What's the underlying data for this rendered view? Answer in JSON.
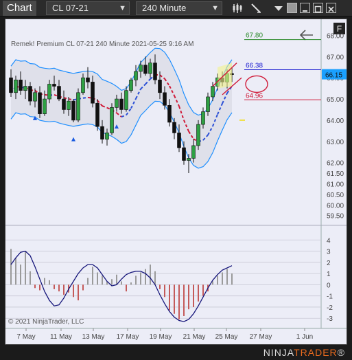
{
  "titlebar": {
    "title": "Chart",
    "instrument": "CL 07-21",
    "interval": "240 Minute",
    "icons": [
      "bar-style-icon",
      "drawing-tool-icon",
      "properties-icon"
    ],
    "window_buttons": [
      "minimize-icon",
      "maximize-icon",
      "close-icon"
    ]
  },
  "chart": {
    "header": "Remek!  Premium  CL 07-21  240 Minute  2021-05-25 9:16 AM",
    "copyright": "© 2021 NinjaTrader, LLC",
    "panel_badge": "F",
    "back_arrow": "left-arrow-icon",
    "price_ticks": [
      "68.00",
      "67.00",
      "66.00",
      "65.00",
      "64.00",
      "63.00",
      "62.00",
      "61.50",
      "61.00",
      "60.50",
      "60.00",
      "59.50"
    ],
    "osc_ticks": [
      "4",
      "3",
      "2",
      "1",
      "0",
      "-1",
      "-2",
      "-3"
    ],
    "date_ticks": [
      "7 May",
      "11 May",
      "13 May",
      "17 May",
      "19 May",
      "21 May",
      "25 May",
      "27 May",
      "1 Jun"
    ],
    "level_labels": {
      "target": "67.80",
      "mid": "66.38",
      "stop": "64.96",
      "last": "66.15"
    },
    "colors": {
      "target": "#2e8b2e",
      "mid": "#1a1ad0",
      "stop": "#d01836",
      "band": "#1e8fff",
      "last_bg": "#1aa0ff"
    }
  },
  "chart_data": {
    "type": "candlestick",
    "ylim": [
      59.2,
      68.6
    ],
    "ohlc": [
      [
        66.0,
        66.4,
        65.1,
        65.3
      ],
      [
        65.3,
        66.1,
        65.0,
        65.9
      ],
      [
        65.9,
        66.3,
        65.2,
        65.4
      ],
      [
        65.4,
        65.9,
        65.0,
        65.6
      ],
      [
        65.6,
        65.8,
        64.7,
        64.9
      ],
      [
        64.9,
        65.5,
        64.6,
        65.3
      ],
      [
        65.3,
        65.6,
        64.1,
        64.3
      ],
      [
        64.3,
        65.4,
        64.2,
        65.0
      ],
      [
        65.0,
        65.9,
        64.8,
        65.7
      ],
      [
        65.7,
        66.1,
        65.4,
        65.6
      ],
      [
        65.6,
        65.9,
        64.9,
        65.0
      ],
      [
        65.0,
        65.4,
        64.3,
        64.5
      ],
      [
        64.5,
        65.1,
        64.2,
        64.9
      ],
      [
        64.9,
        65.0,
        63.9,
        64.0
      ],
      [
        64.0,
        65.5,
        63.9,
        65.3
      ],
      [
        65.3,
        66.2,
        65.2,
        66.0
      ],
      [
        66.0,
        66.5,
        65.5,
        65.8
      ],
      [
        65.8,
        66.1,
        64.6,
        64.8
      ],
      [
        64.8,
        65.0,
        63.5,
        63.7
      ],
      [
        63.7,
        64.0,
        62.9,
        63.1
      ],
      [
        63.1,
        63.6,
        62.8,
        63.4
      ],
      [
        63.4,
        64.8,
        63.3,
        64.6
      ],
      [
        64.6,
        65.2,
        64.4,
        65.0
      ],
      [
        65.0,
        65.3,
        64.3,
        64.5
      ],
      [
        64.5,
        65.6,
        64.4,
        65.4
      ],
      [
        65.4,
        66.0,
        65.3,
        65.9
      ],
      [
        65.9,
        66.6,
        65.6,
        66.3
      ],
      [
        66.3,
        66.8,
        66.0,
        66.6
      ],
      [
        66.6,
        67.0,
        66.1,
        66.2
      ],
      [
        66.2,
        66.9,
        66.0,
        66.7
      ],
      [
        66.7,
        67.1,
        65.7,
        65.9
      ],
      [
        65.9,
        66.3,
        65.0,
        65.3
      ],
      [
        65.3,
        65.6,
        64.5,
        64.7
      ],
      [
        64.7,
        65.0,
        63.7,
        63.9
      ],
      [
        63.9,
        64.1,
        63.1,
        63.4
      ],
      [
        63.4,
        63.8,
        62.5,
        62.7
      ],
      [
        62.7,
        63.0,
        61.9,
        62.1
      ],
      [
        62.1,
        62.4,
        61.5,
        62.2
      ],
      [
        62.2,
        63.1,
        62.0,
        62.8
      ],
      [
        62.8,
        64.0,
        62.6,
        63.8
      ],
      [
        63.8,
        64.6,
        63.6,
        64.4
      ],
      [
        64.4,
        65.3,
        64.2,
        65.1
      ],
      [
        65.1,
        65.8,
        64.9,
        65.6
      ],
      [
        65.6,
        66.2,
        65.4,
        66.0
      ],
      [
        66.0,
        66.3,
        65.6,
        65.8
      ],
      [
        65.8,
        66.4,
        65.5,
        66.2
      ],
      [
        66.2,
        66.5,
        65.8,
        66.15
      ]
    ],
    "oscillator_histogram": [
      3.2,
      2.4,
      1.8,
      3.0,
      1.2,
      -0.3,
      -0.5,
      0.6,
      0.4,
      -0.4,
      -0.6,
      -0.9,
      -0.7,
      -1.1,
      -1.4,
      -0.5,
      0.6,
      1.6,
      1.1,
      0.8,
      0.3,
      0.5,
      0.9,
      0.3,
      -0.6,
      0.2,
      0.8,
      1.1,
      1.4,
      1.8,
      1.2,
      -0.4,
      -1.1,
      -2.3,
      -2.6,
      -3.1,
      -2.8,
      -2.2,
      -2.0,
      -1.5,
      -1.0,
      -0.6,
      0.3,
      0.8,
      1.1,
      1.4,
      1.0
    ],
    "oscillator_line": [
      1.8,
      2.4,
      2.9,
      3.0,
      2.6,
      1.6,
      0.5,
      -0.6,
      -1.4,
      -1.9,
      -1.8,
      -1.2,
      -0.4,
      0.3,
      1.0,
      1.5,
      1.8,
      1.8,
      1.5,
      0.9,
      0.3,
      -0.1,
      0.0,
      0.5,
      0.9,
      1.1,
      1.2,
      1.2,
      1.0,
      0.6,
      0.0,
      -0.9,
      -1.7,
      -2.4,
      -2.9,
      -3.2,
      -3.3,
      -3.1,
      -2.6,
      -1.9,
      -1.1,
      -0.3,
      0.4,
      0.9,
      1.3,
      1.5,
      1.7
    ]
  }
}
